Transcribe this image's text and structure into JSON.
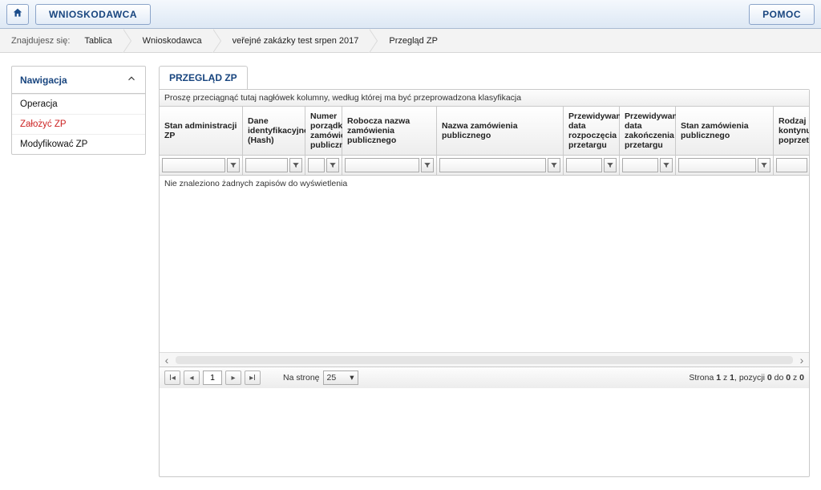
{
  "topbar": {
    "wnioskodawca": "WNIOSKODAWCA",
    "pomoc": "POMOC"
  },
  "breadcrumb": {
    "label": "Znajdujesz się:",
    "items": [
      "Tablica",
      "Wnioskodawca",
      "veřejné zakázky test srpen 2017",
      "Przegląd ZP"
    ]
  },
  "sidebar": {
    "title": "Nawigacja",
    "items": [
      {
        "label": "Operacja",
        "active": false
      },
      {
        "label": "Założyć ZP",
        "active": true
      },
      {
        "label": "Modyfikować ZP",
        "active": false
      }
    ]
  },
  "tab": {
    "label": "PRZEGLĄD ZP"
  },
  "grid": {
    "group_hint": "Proszę przeciągnąć tutaj nagłówek kolumny, według której ma być przeprowadzona klasyfikacja",
    "columns": [
      "Stan administracji ZP",
      "Dane identyfikacyjne (Hash)",
      "Numer porządkowy zamówienia publicznego",
      "Robocza nazwa zamówienia publicznego",
      "Nazwa zamówienia publicznego",
      "Przewidywana data rozpoczęcia przetargu",
      "Przewidywana data zakończenia przetargu",
      "Stan zamówienia publicznego",
      "Rodzaj kontynuacji poprzetargowej"
    ],
    "empty": "Nie znaleziono żadnych zapisów do wyświetlenia"
  },
  "pager": {
    "per_page_label": "Na stronę",
    "page_value": "1",
    "per_page_value": "25",
    "summary_prefix": "Strona ",
    "summary_page_cur": "1",
    "summary_page_mid": " z ",
    "summary_page_total": "1",
    "summary_pos_prefix": ", pozycji ",
    "summary_pos_from": "0",
    "summary_pos_mid1": " do ",
    "summary_pos_to": "0",
    "summary_pos_mid2": " z ",
    "summary_pos_total": "0"
  }
}
